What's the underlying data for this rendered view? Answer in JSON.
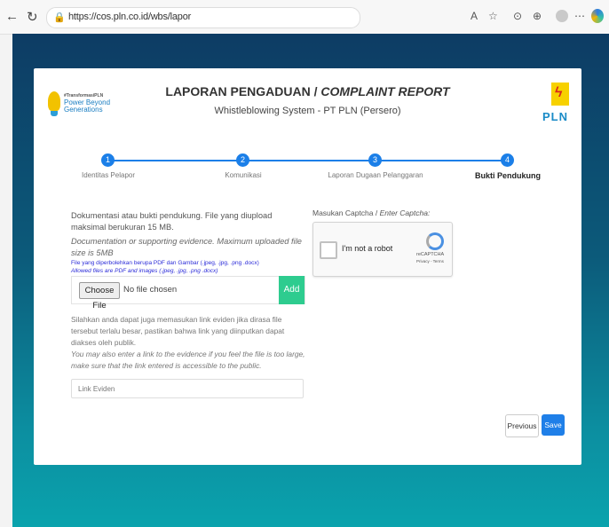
{
  "browser": {
    "url": "https://cos.pln.co.id/wbs/lapor",
    "url_host": "cos.pln.co.id",
    "url_path": "/wbs/lapor"
  },
  "header": {
    "title_id": "LAPORAN PENGADUAN / ",
    "title_en": "COMPLAINT REPORT",
    "subtitle": "Whistleblowing System - PT PLN (Persero)",
    "logo_left_tag": "#TransformasiPLN",
    "logo_left_line1": "Power Beyond",
    "logo_left_line2": "Generations",
    "logo_right_text": "PLN"
  },
  "stepper": {
    "steps": [
      {
        "num": "1",
        "label": "Identitas Pelapor"
      },
      {
        "num": "2",
        "label": "Komunikasi"
      },
      {
        "num": "3",
        "label": "Laporan Dugaan Pelanggaran"
      },
      {
        "num": "4",
        "label": "Bukti Pendukung"
      }
    ],
    "active_index": 3
  },
  "form": {
    "desc_id": "Dokumentasi atau bukti pendukung. File yang diupload maksimal berukuran 15 MB.",
    "desc_en": "Documentation or supporting evidence. Maximum uploaded file size is 5MB",
    "note_id": "File yang diperbolehkan berupa PDF dan Gambar (.jpeg, .jpg, .png .docx)",
    "note_en": "Allowed files are PDF and images (.jpeg, .jpg, .png .docx)",
    "choose_file_label": "Choose File",
    "no_file_text": "No file chosen",
    "add_label": "Add",
    "link_desc_id": "Silahkan anda dapat juga memasukan link eviden jika dirasa file tersebut terlalu besar, pastikan bahwa link yang diinputkan dapat diakses oleh publik.",
    "link_desc_en": "You may also enter a link to the evidence if you feel the file is too large, make sure that the link entered is accessible to the public.",
    "link_placeholder": "Link Eviden"
  },
  "captcha": {
    "label_id": "Masukan Captcha / ",
    "label_en": "Enter Captcha:",
    "checkbox_text": "I'm not a robot",
    "brand": "reCAPTCHA",
    "links": "Privacy - Terms"
  },
  "actions": {
    "previous_label": "Previous",
    "save_label": "Save"
  },
  "colors": {
    "accent": "#1f7fe8",
    "add_button": "#2ecc8f",
    "bg_top": "#0d3c64",
    "bg_bottom": "#0aa3ad"
  }
}
